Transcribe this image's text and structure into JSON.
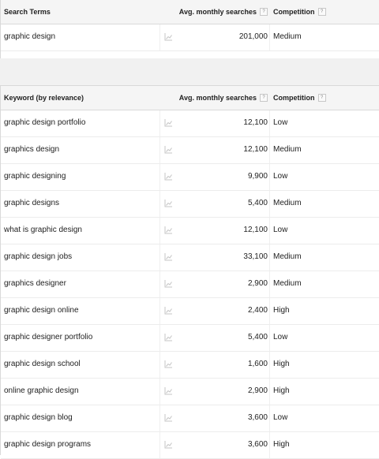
{
  "search_terms_table": {
    "header": {
      "keyword_label": "Search Terms",
      "avg_label": "Avg. monthly searches",
      "competition_label": "Competition",
      "help_glyph": "?"
    },
    "rows": [
      {
        "keyword": "graphic design",
        "avg": "201,000",
        "competition": "Medium"
      }
    ]
  },
  "keyword_ideas_table": {
    "header": {
      "keyword_label": "Keyword (by relevance)",
      "avg_label": "Avg. monthly searches",
      "competition_label": "Competition",
      "help_glyph": "?"
    },
    "rows": [
      {
        "keyword": "graphic design portfolio",
        "avg": "12,100",
        "competition": "Low"
      },
      {
        "keyword": "graphics design",
        "avg": "12,100",
        "competition": "Medium"
      },
      {
        "keyword": "graphic designing",
        "avg": "9,900",
        "competition": "Low"
      },
      {
        "keyword": "graphic designs",
        "avg": "5,400",
        "competition": "Medium"
      },
      {
        "keyword": "what is graphic design",
        "avg": "12,100",
        "competition": "Low"
      },
      {
        "keyword": "graphic design jobs",
        "avg": "33,100",
        "competition": "Medium"
      },
      {
        "keyword": "graphics designer",
        "avg": "2,900",
        "competition": "Medium"
      },
      {
        "keyword": "graphic design online",
        "avg": "2,400",
        "competition": "High"
      },
      {
        "keyword": "graphic designer portfolio",
        "avg": "5,400",
        "competition": "Low"
      },
      {
        "keyword": "graphic design school",
        "avg": "1,600",
        "competition": "High"
      },
      {
        "keyword": "online graphic design",
        "avg": "2,900",
        "competition": "High"
      },
      {
        "keyword": "graphic design blog",
        "avg": "3,600",
        "competition": "Low"
      },
      {
        "keyword": "graphic design programs",
        "avg": "3,600",
        "competition": "High"
      }
    ]
  },
  "icons": {
    "trend": "trend-chart-icon",
    "help": "help-icon"
  },
  "colors": {
    "header_bg": "#f5f5f5",
    "gap_bg": "#f1f1f1",
    "border": "#d9d9d9",
    "icon": "#bdbdbd"
  }
}
